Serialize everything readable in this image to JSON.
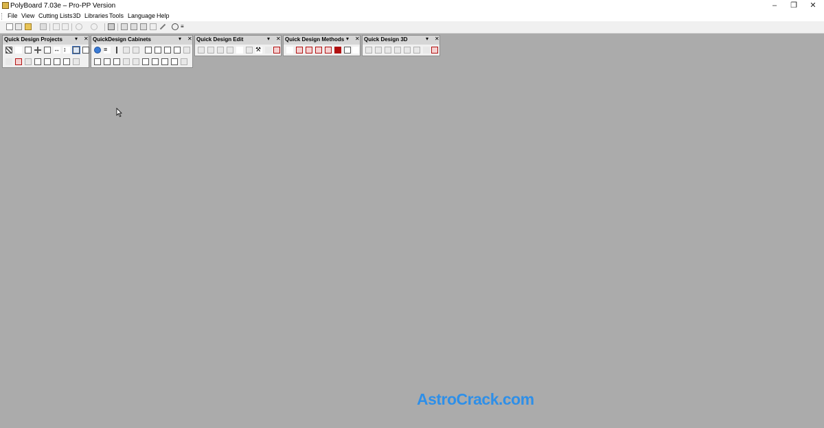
{
  "window": {
    "title": "PolyBoard 7.03e – Pro-PP Version",
    "minimize_icon": "–",
    "restore_icon": "❐",
    "close_icon": "✕"
  },
  "menu": {
    "items": [
      "File",
      "View",
      "Cutting Lists",
      "3D",
      "Libraries",
      "Tools",
      "Language",
      "Help"
    ]
  },
  "panels": [
    {
      "title": "Quick Design Projects",
      "dropdown": "▾",
      "close": "✕"
    },
    {
      "title": "QuickDesign Cabinets",
      "dropdown": "▾",
      "close": "✕"
    },
    {
      "title": "Quick Design Edit",
      "dropdown": "▾",
      "close": "✕"
    },
    {
      "title": "Quick Design Methods",
      "dropdown": "▾",
      "close": "✕"
    },
    {
      "title": "Quick Design 3D",
      "dropdown": "▾",
      "close": "✕"
    }
  ],
  "watermark": "AstroCrack.com"
}
